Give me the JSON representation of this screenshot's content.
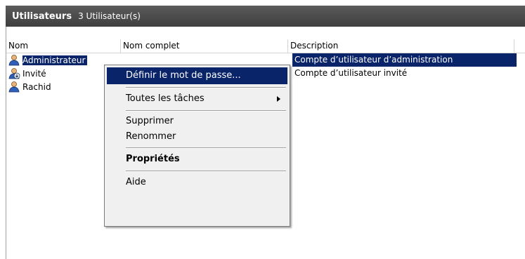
{
  "title_bar": {
    "title": "Utilisateurs",
    "count": "3 Utilisateur(s)"
  },
  "columns": [
    "Nom",
    "Nom complet",
    "Description"
  ],
  "users": [
    {
      "name": "Administrateur",
      "fullname": "",
      "description": "Compte d’utilisateur d’administration",
      "icon": "admin-user-icon",
      "selected": true
    },
    {
      "name": "Invité",
      "fullname": "",
      "description": "Compte d’utilisateur invité",
      "icon": "disabled-user-icon",
      "selected": false
    },
    {
      "name": "Rachid",
      "fullname": "",
      "description": "",
      "icon": "user-icon",
      "selected": false
    }
  ],
  "context_menu": {
    "set_password": "Définir le mot de passe...",
    "all_tasks": "Toutes les tâches",
    "delete": "Supprimer",
    "rename": "Renommer",
    "properties": "Propriétés",
    "help": "Aide"
  },
  "colors": {
    "selection": "#0a246a",
    "title_bar": "#4a4a4a",
    "menu_bg": "#f0f0f0"
  }
}
